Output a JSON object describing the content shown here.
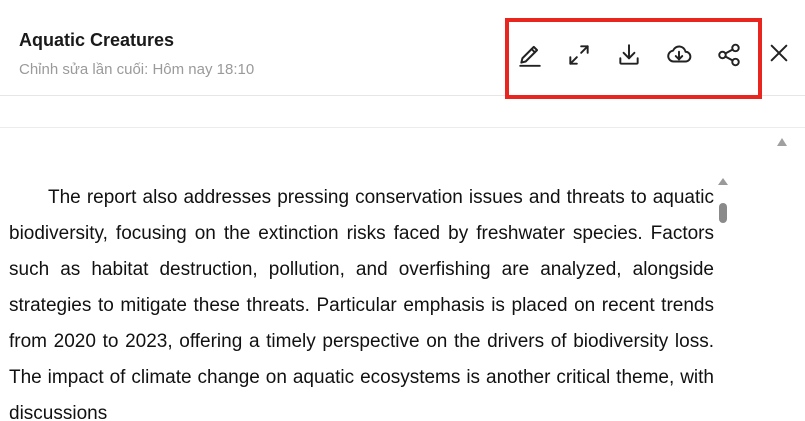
{
  "document": {
    "title": "Aquatic Creatures",
    "last_edited": "Chỉnh sửa lần cuối: Hôm nay 18:10",
    "paragraph": "The report also addresses pressing conservation issues and threats to aquatic biodiversity, focusing on the extinction risks faced by freshwater species. Factors such as habitat destruction, pollution, and overfishing are analyzed, alongside strategies to mitigate these threats. Particular emphasis is placed on recent trends from 2020 to 2023, offering a timely perspective on the drivers of biodiversity loss. The impact of climate change on aquatic ecosystems is another critical theme, with discussions"
  },
  "toolbar": {
    "highlight_color": "#e8251f",
    "icons": [
      "pencil-icon",
      "expand-icon",
      "download-icon",
      "cloud-download-icon",
      "share-icon"
    ]
  },
  "window": {
    "close_icon": "close-icon"
  }
}
